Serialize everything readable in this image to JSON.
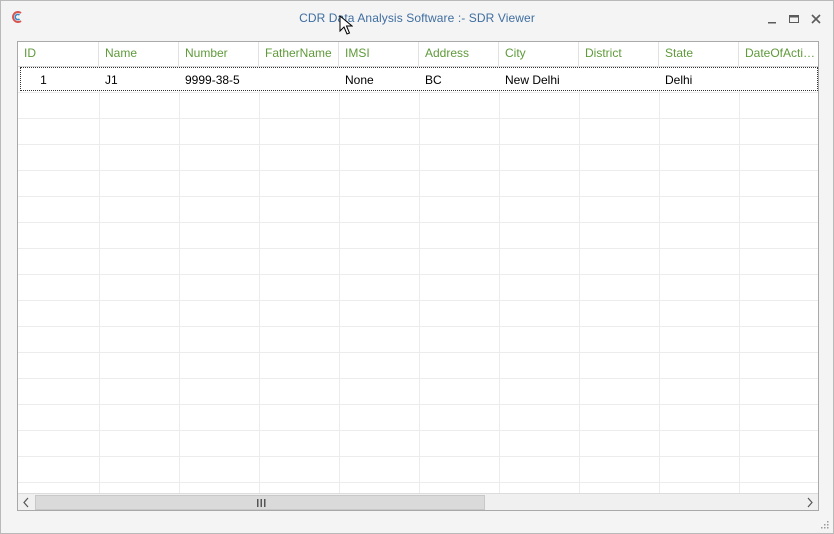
{
  "window": {
    "title": "CDR Data Analysis Software :-  SDR Viewer",
    "icon": "app-logo-icon",
    "controls": [
      "minimize-icon",
      "maximize-icon",
      "close-icon"
    ]
  },
  "grid": {
    "columns": [
      "ID",
      "Name",
      "Number",
      "FatherName",
      "IMSI",
      "Address",
      "City",
      "District",
      "State",
      "DateOfActiv..."
    ],
    "rows": [
      {
        "ID": "1",
        "Name": "J1",
        "Number": "9999-38-5",
        "FatherName": "",
        "IMSI": "None",
        "Address": "BC",
        "City": "New Delhi",
        "District": "",
        "State": "Delhi",
        "DateOfActivation": ""
      }
    ],
    "header_color": "#5f9a3a",
    "title_color": "#3f6ea0"
  },
  "scrollbar": {
    "left_icon": "chevron-left-icon",
    "right_icon": "chevron-right-icon",
    "thumb_grip_icon": "grip-icon"
  }
}
